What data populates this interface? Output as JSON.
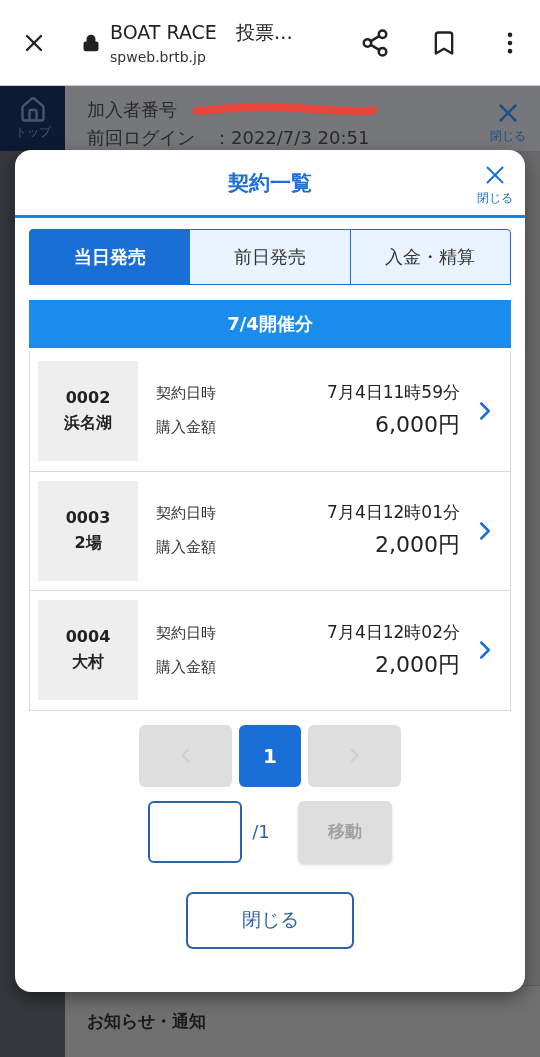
{
  "browser": {
    "title": "BOAT RACE　投票…",
    "url": "spweb.brtb.jp"
  },
  "background": {
    "home_label": "トップ",
    "member_label": "加入者番号",
    "last_login": "前回ログイン　：2022/7/3 20:51",
    "close_label": "閉じる",
    "notice": "お知らせ・通知"
  },
  "modal": {
    "title": "契約一覧",
    "close_label": "閉じる",
    "tabs": [
      {
        "label": "当日発売",
        "selected": true
      },
      {
        "label": "前日発売",
        "selected": false
      },
      {
        "label": "入金・精算",
        "selected": false
      }
    ],
    "date_header": "7/4開催分",
    "contracts": [
      {
        "code": "0002",
        "venue": "浜名湖",
        "date_label": "契約日時",
        "date": "7月4日11時59分",
        "amount_label": "購入金額",
        "amount": "6,000円"
      },
      {
        "code": "0003",
        "venue": "2場",
        "date_label": "契約日時",
        "date": "7月4日12時01分",
        "amount_label": "購入金額",
        "amount": "2,000円"
      },
      {
        "code": "0004",
        "venue": "大村",
        "date_label": "契約日時",
        "date": "7月4日12時02分",
        "amount_label": "購入金額",
        "amount": "2,000円"
      }
    ],
    "pagination": {
      "prev_disabled": true,
      "next_disabled": true,
      "pages": [
        {
          "label": "1",
          "selected": true
        }
      ]
    },
    "jump": {
      "total": "/1",
      "button": "移動",
      "disabled": true
    },
    "close_button": "閉じる"
  }
}
